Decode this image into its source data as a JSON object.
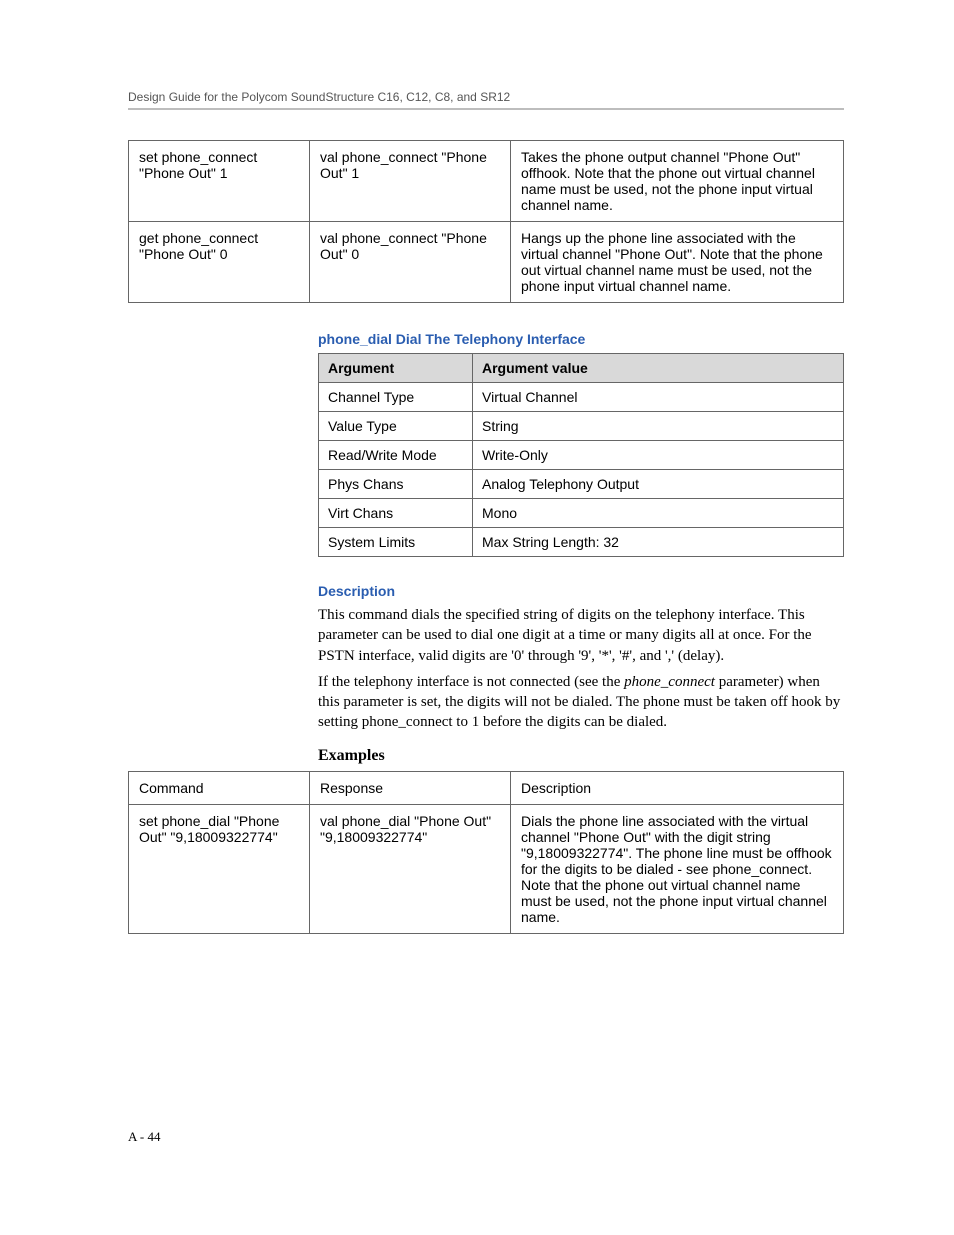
{
  "header": "Design Guide for the Polycom SoundStructure C16, C12, C8, and SR12",
  "topTable": {
    "rows": [
      {
        "c1": "set phone_connect \"Phone Out\" 1",
        "c2": "val phone_connect \"Phone Out\" 1",
        "c3": "Takes the phone output channel \"Phone Out\" offhook. Note that the phone out virtual channel name must be used, not the phone input virtual channel name."
      },
      {
        "c1": "get phone_connect \"Phone Out\" 0",
        "c2": "val phone_connect \"Phone Out\" 0",
        "c3": "Hangs up the phone line associated with the virtual channel \"Phone Out\". Note that the phone out virtual channel name must be used, not the phone input virtual channel name."
      }
    ]
  },
  "sectionTitle": "phone_dial Dial The Telephony Interface",
  "argsTable": {
    "head1": "Argument",
    "head2": "Argument value",
    "rows": [
      {
        "k": "Channel Type",
        "v": "Virtual Channel"
      },
      {
        "k": "Value Type",
        "v": "String"
      },
      {
        "k": "Read/Write Mode",
        "v": "Write-Only"
      },
      {
        "k": "Phys Chans",
        "v": "Analog Telephony Output"
      },
      {
        "k": "Virt Chans",
        "v": "Mono"
      },
      {
        "k": "System Limits",
        "v": "Max String Length: 32"
      }
    ]
  },
  "descriptionLabel": "Description",
  "description": {
    "p1": "This command dials the specified string of digits on the telephony interface. This parameter can be used to dial one digit at a time or many digits all at once. For the PSTN interface, valid digits are '0' through '9', '*', '#', and ',' (delay).",
    "p2a": "If the telephony interface is not connected (see the ",
    "p2_em": "phone_connect",
    "p2b": " parameter) when this parameter is set, the digits will not be dialed. The phone must be taken off hook by setting phone_connect to 1 before the digits can be dialed."
  },
  "examplesLabel": "Examples",
  "examplesTable": {
    "head": {
      "c1": "Command",
      "c2": "Response",
      "c3": "Description"
    },
    "rows": [
      {
        "c1": "set phone_dial \"Phone Out\" \"9,18009322774\"",
        "c2": "val phone_dial \"Phone Out\" \"9,18009322774\"",
        "c3": "Dials the phone line associated with the virtual channel \"Phone Out\" with the digit string \"9,18009322774\". The phone line must be offhook for the digits to be dialed - see phone_connect. Note that the phone out virtual channel name must be used, not the phone input virtual channel name."
      }
    ]
  },
  "pageNumber": "A - 44"
}
